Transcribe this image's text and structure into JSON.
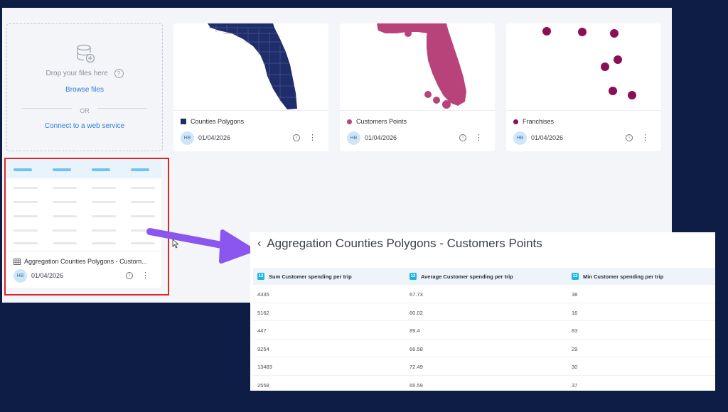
{
  "dropzone": {
    "drop_text": "Drop your files here",
    "browse_label": "Browse files",
    "or_label": "OR",
    "connect_label": "Connect to a web service"
  },
  "cards": [
    {
      "title": "Counties Polygons",
      "avatar": "HB",
      "date": "01/04/2026",
      "legend_color": "#1f2d6a"
    },
    {
      "title": "Customers Points",
      "avatar": "HB",
      "date": "01/04/2026",
      "legend_color": "#b8437a"
    },
    {
      "title": "Franchises",
      "avatar": "HB",
      "date": "01/04/2026",
      "legend_color": "#8a0f57"
    }
  ],
  "table_card": {
    "title": "Aggregation Counties Polygons - Custom...",
    "avatar": "HB",
    "date": "01/04/2026"
  },
  "aggregation": {
    "title": "Aggregation Counties Polygons - Customers Points",
    "columns": [
      "Sum Customer spending per trip",
      "Average Customer spending per trip",
      "Min Customer spending per trip"
    ],
    "rows": [
      [
        "4335",
        "67.73",
        "38"
      ],
      [
        "5162",
        "60.02",
        "16"
      ],
      [
        "447",
        "89.4",
        "83"
      ],
      [
        "9254",
        "66.58",
        "29"
      ],
      [
        "13483",
        "72.49",
        "30"
      ],
      [
        "2558",
        "65.59",
        "37"
      ]
    ]
  },
  "icons": {
    "info": "i",
    "kebab": "⋮",
    "back": "‹",
    "help": "?",
    "number_type": "12"
  },
  "colors": {
    "highlight": "#e02424",
    "arrow": "#8b55f0",
    "link": "#2b7de1",
    "polygons": "#1f2d6a",
    "customers": "#b8437a",
    "franchises": "#8a0f57"
  }
}
